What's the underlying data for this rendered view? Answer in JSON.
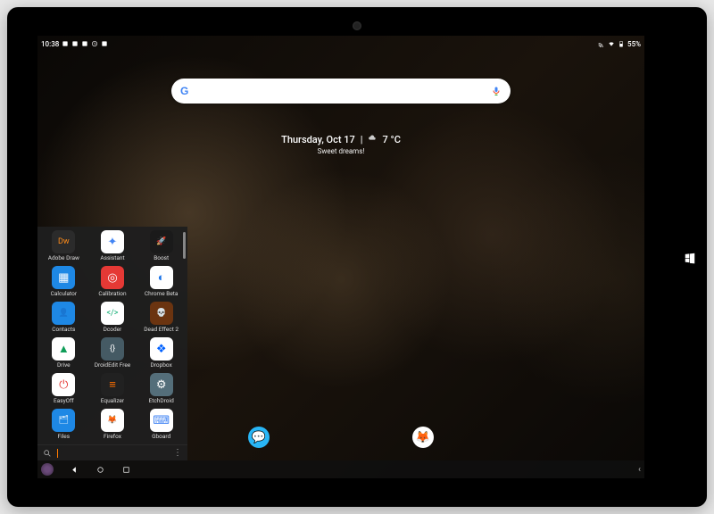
{
  "status": {
    "time": "10:38",
    "battery_text": "55%"
  },
  "search": {
    "placeholder": ""
  },
  "widget": {
    "date": "Thursday, Oct 17",
    "temp": "7 °C",
    "subtitle": "Sweet dreams!"
  },
  "drawer": {
    "apps": [
      {
        "label": "Adobe Draw",
        "bg": "#2b2b2b",
        "glyph": "Dw",
        "fg": "#ff8c1a"
      },
      {
        "label": "Assistant",
        "bg": "#ffffff",
        "glyph": "✦",
        "fg": "#4285F4"
      },
      {
        "label": "Boost",
        "bg": "#1a1a1a",
        "glyph": "🚀",
        "fg": "#ffd34d"
      },
      {
        "label": "Calculator",
        "bg": "#1e88e5",
        "glyph": "▦",
        "fg": "#ffffff"
      },
      {
        "label": "Calibration",
        "bg": "#e53935",
        "glyph": "◎",
        "fg": "#ffffff"
      },
      {
        "label": "Chrome Beta",
        "bg": "#ffffff",
        "glyph": "◐",
        "fg": "#1a73e8"
      },
      {
        "label": "Contacts",
        "bg": "#1e88e5",
        "glyph": "👤",
        "fg": "#ffffff"
      },
      {
        "label": "Dcoder",
        "bg": "#ffffff",
        "glyph": "</>",
        "fg": "#00a86b"
      },
      {
        "label": "Dead Effect 2",
        "bg": "#6b3410",
        "glyph": "💀",
        "fg": "#ffb366"
      },
      {
        "label": "Drive",
        "bg": "#ffffff",
        "glyph": "▲",
        "fg": "#0f9d58"
      },
      {
        "label": "DroidEdit Free",
        "bg": "#455a64",
        "glyph": "{}",
        "fg": "#ffffff"
      },
      {
        "label": "Dropbox",
        "bg": "#ffffff",
        "glyph": "❖",
        "fg": "#0061ff"
      },
      {
        "label": "EasyOff",
        "bg": "#ffffff",
        "glyph": "⏻",
        "fg": "#e53935"
      },
      {
        "label": "Equalizer",
        "bg": "#212121",
        "glyph": "≡",
        "fg": "#ff6f00"
      },
      {
        "label": "EtchDroid",
        "bg": "#546e7a",
        "glyph": "⚙",
        "fg": "#ffffff"
      },
      {
        "label": "Files",
        "bg": "#1e88e5",
        "glyph": "🗂",
        "fg": "#ffffff"
      },
      {
        "label": "Firefox",
        "bg": "#ffffff",
        "glyph": "🦊",
        "fg": "#ff7139"
      },
      {
        "label": "Gboard",
        "bg": "#ffffff",
        "glyph": "⌨",
        "fg": "#4285F4"
      }
    ]
  },
  "dock": {
    "items": [
      {
        "name": "messages-app",
        "bg": "#29b6f6",
        "glyph": "💬"
      },
      {
        "name": "firefox-app",
        "bg": "#ffffff",
        "glyph": "🦊"
      }
    ]
  }
}
